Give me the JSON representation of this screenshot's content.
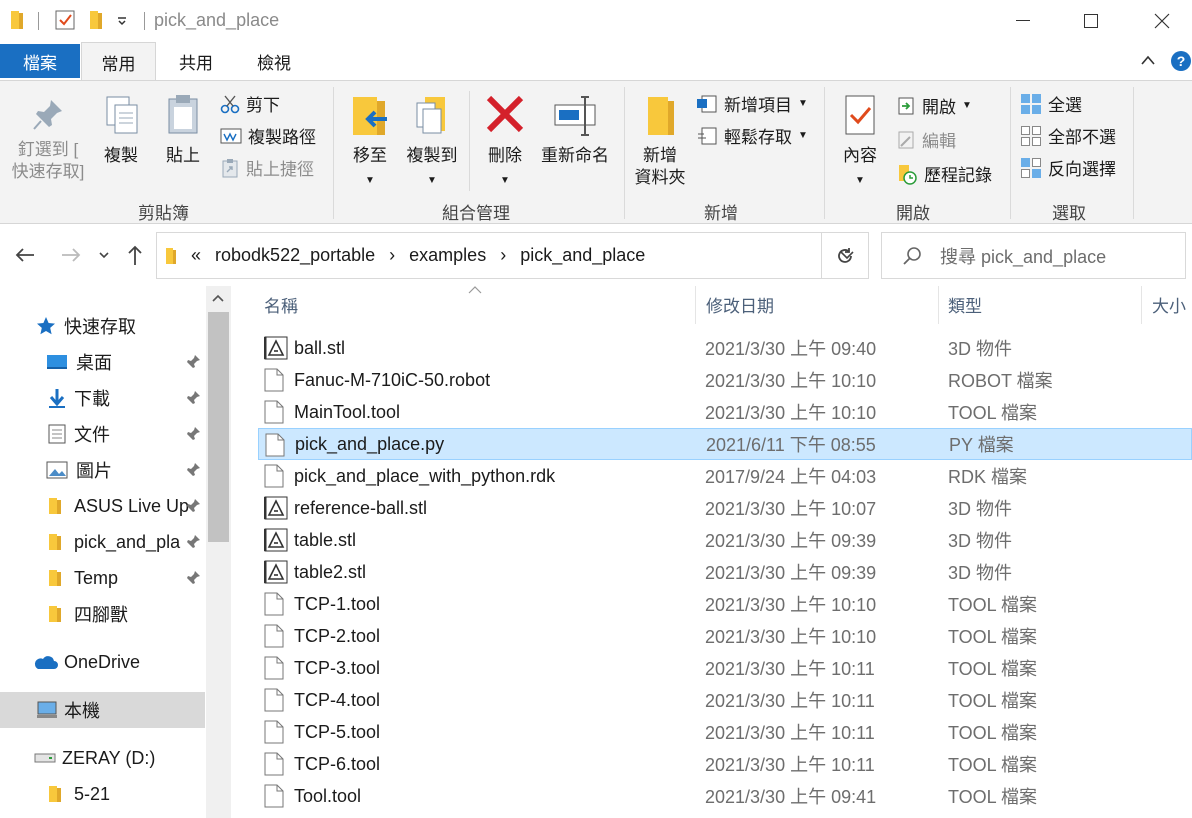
{
  "window": {
    "title": "pick_and_place"
  },
  "tabs": {
    "file": "檔案",
    "home": "常用",
    "share": "共用",
    "view": "檢視"
  },
  "ribbon": {
    "clipboard": {
      "label": "剪貼簿",
      "pin_line1": "釘選到 [",
      "pin_line2": "快速存取]",
      "copy": "複製",
      "paste": "貼上",
      "cut": "剪下",
      "copy_path": "複製路徑",
      "paste_shortcut": "貼上捷徑"
    },
    "organize": {
      "label": "組合管理",
      "move_to": "移至",
      "copy_to": "複製到",
      "delete": "刪除",
      "rename": "重新命名"
    },
    "new": {
      "label": "新增",
      "new_folder_line1": "新增",
      "new_folder_line2": "資料夾",
      "new_item": "新增項目",
      "easy_access": "輕鬆存取"
    },
    "open": {
      "label": "開啟",
      "properties": "內容",
      "open": "開啟",
      "edit": "編輯",
      "history": "歷程記錄"
    },
    "select": {
      "label": "選取",
      "select_all": "全選",
      "select_none": "全部不選",
      "invert": "反向選擇"
    }
  },
  "address": {
    "overflow": "«",
    "crumbs": [
      "robodk522_portable",
      "examples",
      "pick_and_place"
    ],
    "search_placeholder": "搜尋 pick_and_place"
  },
  "navpane": {
    "quick_access": "快速存取",
    "items": [
      "桌面",
      "下載",
      "文件",
      "圖片",
      "ASUS Live Up",
      "pick_and_pla",
      "Temp",
      "四腳獸"
    ],
    "onedrive": "OneDrive",
    "this_pc": "本機",
    "drive": "ZERAY (D:)",
    "drive_child": "5-21"
  },
  "columns": {
    "name": "名稱",
    "date": "修改日期",
    "type": "類型",
    "size": "大小"
  },
  "files": [
    {
      "name": "ball.stl",
      "date": "2021/3/30 上午 09:40",
      "type": "3D 物件",
      "icon": "stl-icon"
    },
    {
      "name": "Fanuc-M-710iC-50.robot",
      "date": "2021/3/30 上午 10:10",
      "type": "ROBOT 檔案",
      "icon": "file-icon"
    },
    {
      "name": "MainTool.tool",
      "date": "2021/3/30 上午 10:10",
      "type": "TOOL 檔案",
      "icon": "file-icon"
    },
    {
      "name": "pick_and_place.py",
      "date": "2021/6/11 下午 08:55",
      "type": "PY 檔案",
      "icon": "file-icon"
    },
    {
      "name": "pick_and_place_with_python.rdk",
      "date": "2017/9/24 上午 04:03",
      "type": "RDK 檔案",
      "icon": "file-icon"
    },
    {
      "name": "reference-ball.stl",
      "date": "2021/3/30 上午 10:07",
      "type": "3D 物件",
      "icon": "stl-icon"
    },
    {
      "name": "table.stl",
      "date": "2021/3/30 上午 09:39",
      "type": "3D 物件",
      "icon": "stl-icon"
    },
    {
      "name": "table2.stl",
      "date": "2021/3/30 上午 09:39",
      "type": "3D 物件",
      "icon": "stl-icon"
    },
    {
      "name": "TCP-1.tool",
      "date": "2021/3/30 上午 10:10",
      "type": "TOOL 檔案",
      "icon": "file-icon"
    },
    {
      "name": "TCP-2.tool",
      "date": "2021/3/30 上午 10:10",
      "type": "TOOL 檔案",
      "icon": "file-icon"
    },
    {
      "name": "TCP-3.tool",
      "date": "2021/3/30 上午 10:11",
      "type": "TOOL 檔案",
      "icon": "file-icon"
    },
    {
      "name": "TCP-4.tool",
      "date": "2021/3/30 上午 10:11",
      "type": "TOOL 檔案",
      "icon": "file-icon"
    },
    {
      "name": "TCP-5.tool",
      "date": "2021/3/30 上午 10:11",
      "type": "TOOL 檔案",
      "icon": "file-icon"
    },
    {
      "name": "TCP-6.tool",
      "date": "2021/3/30 上午 10:11",
      "type": "TOOL 檔案",
      "icon": "file-icon"
    },
    {
      "name": "Tool.tool",
      "date": "2021/3/30 上午 09:41",
      "type": "TOOL 檔案",
      "icon": "file-icon"
    }
  ],
  "selected_file": "pick_and_place.py",
  "colors": {
    "accent": "#1a6fc2",
    "selection": "#cce8ff",
    "selection_border": "#99d1ff",
    "folder": "#f8c83c"
  }
}
